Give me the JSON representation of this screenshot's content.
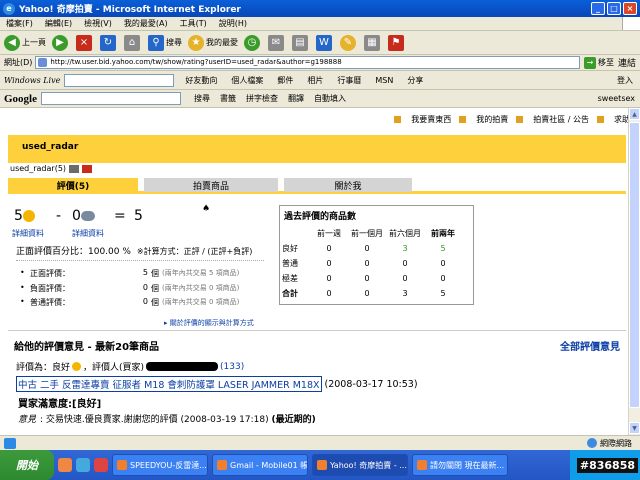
{
  "window": {
    "title": "Yahoo! 奇摩拍賣 - Microsoft Internet Explorer"
  },
  "menu": [
    "檔案(F)",
    "編輯(E)",
    "檢視(V)",
    "我的最愛(A)",
    "工具(T)",
    "說明(H)"
  ],
  "toolbar": {
    "back": "上一頁",
    "search": "搜尋",
    "favorites": "我的最愛"
  },
  "address": {
    "label": "網址(D)",
    "url": "http://tw.user.bid.yahoo.com/tw/show/rating?userID=used_radar&author=g198888",
    "go": "移至",
    "links": "連結"
  },
  "livebar": {
    "brand": "Windows Live",
    "items": [
      "好友動向",
      "個人檔案",
      "郵件",
      "相片",
      "行事曆",
      "MSN",
      "分享"
    ],
    "signin": "登入"
  },
  "googlebar": {
    "brand": "Google",
    "items": [
      "搜尋",
      "書籤",
      "拼字檢查",
      "翻譯",
      "自動填入",
      "sweetsex"
    ]
  },
  "page": {
    "toplinks": [
      "我要賣東西",
      "我的拍賣",
      "拍賣社區 / 公告",
      "求助"
    ],
    "username": "used_radar",
    "usersub": "used_radar(5)",
    "tabs": [
      "評價(5)",
      "拍賣商品",
      "關於我"
    ],
    "summary": {
      "positive": "5",
      "minus": "-",
      "negative": "0",
      "equals": "=",
      "total": "5",
      "positive_link": "詳細資料",
      "negative_link": "詳細資料",
      "percent_label": "正面評價百分比：100.00 %",
      "rule": "※計算方式：正評 / (正評+負評)"
    },
    "breakdown": [
      {
        "label": "正面評價：",
        "count": "5",
        "unit": "個",
        "note": "(兩年內共交易 5 項商品)"
      },
      {
        "label": "負面評價：",
        "count": "0",
        "unit": "個",
        "note": "(兩年內共交易 0 項商品)"
      },
      {
        "label": "普通評價：",
        "count": "0",
        "unit": "個",
        "note": "(兩年內共交易 0 項商品)"
      }
    ],
    "stats": {
      "title": "過去評價的商品數",
      "headers": [
        "前一週",
        "前一個月",
        "前六個月",
        "前兩年"
      ],
      "rows": [
        {
          "label": "良好",
          "values": [
            "0",
            "0",
            "3",
            "5"
          ]
        },
        {
          "label": "普通",
          "values": [
            "0",
            "0",
            "0",
            "0"
          ]
        },
        {
          "label": "極差",
          "values": [
            "0",
            "0",
            "0",
            "0"
          ]
        },
        {
          "label": "合計",
          "values": [
            "0",
            "0",
            "3",
            "5"
          ]
        }
      ]
    },
    "explain_link": "關於評價的顯示與計算方式",
    "section_title": "給他的評價意見 - 最新20筆商品",
    "all_link": "全部評價意見",
    "entry": {
      "rating": "評價為：良好",
      "rater": "，評價人(買家)",
      "count": "(133)",
      "item": "中古 二手 反雷達專賣 征服者 M18 會刺防護罩 LASER JAMMER M18X",
      "item_time": "(2008-03-17 10:53)",
      "buyer_title": "買家滿意度:[良好]",
      "reply_label": "意見",
      "reply_text": ": 交易快速.優良賣家.謝謝您的評價 (2008-03-19 17:18)",
      "reply_latest": "(最近期的)"
    }
  },
  "status": {
    "zone": "網際網路"
  },
  "taskbar": {
    "start": "開始",
    "tasks": [
      "SPEEDYOU-反雷達...",
      "Gmail - Mobile01 帳...",
      "Yahoo! 奇摩拍賣 - ...",
      "請勿關閉 現在最新..."
    ],
    "clock": "#836858"
  }
}
